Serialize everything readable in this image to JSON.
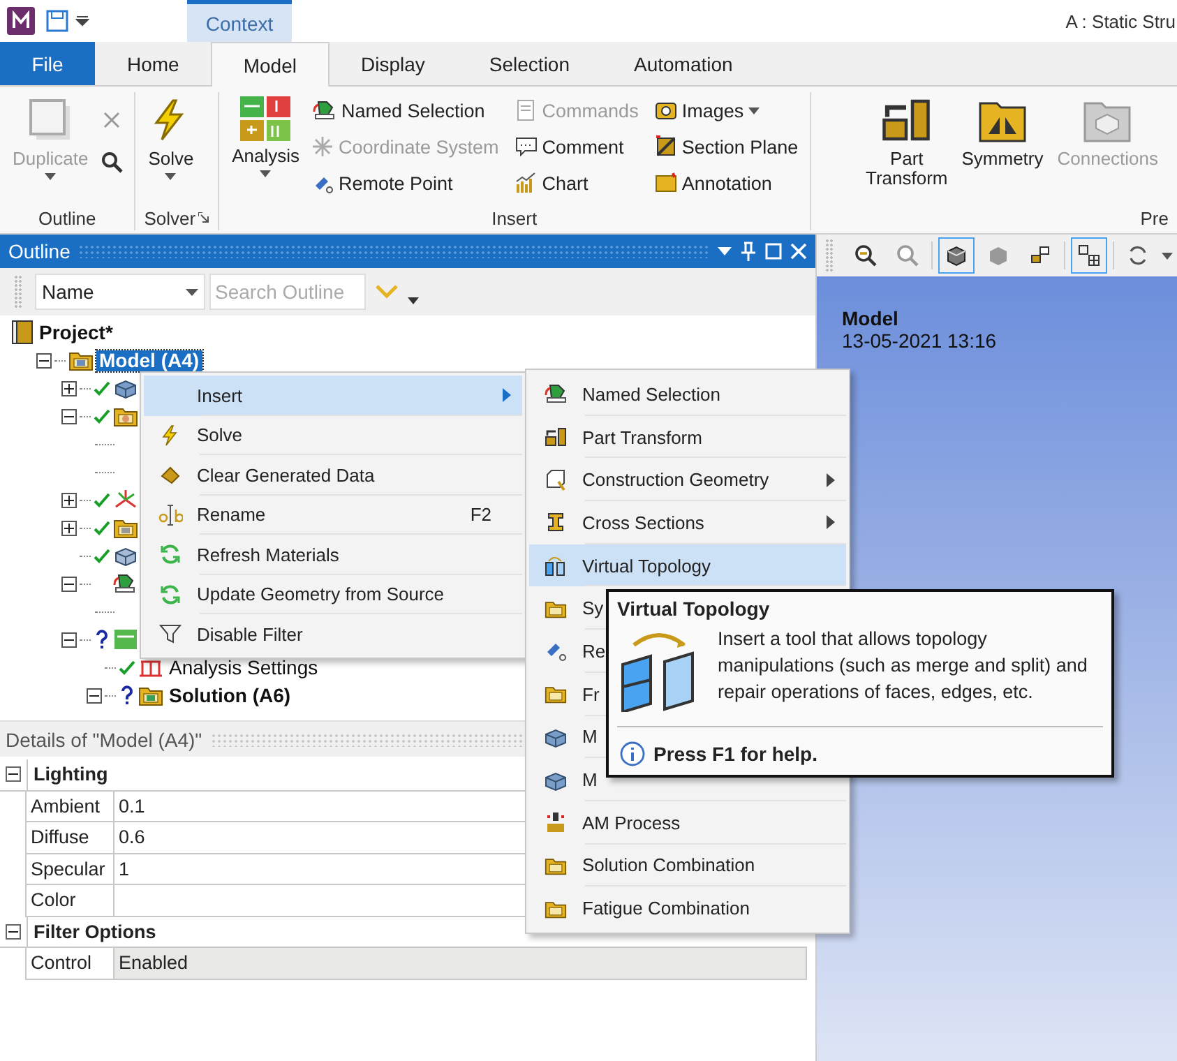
{
  "app": {
    "title": "A : Static Stru",
    "context_tab": "Context"
  },
  "tabs": [
    {
      "label": "File",
      "kind": "file",
      "selected": false
    },
    {
      "label": "Home",
      "kind": "tab",
      "selected": false
    },
    {
      "label": "Model",
      "kind": "tab",
      "selected": true
    },
    {
      "label": "Display",
      "kind": "tab",
      "selected": false
    },
    {
      "label": "Selection",
      "kind": "tab",
      "selected": false
    },
    {
      "label": "Automation",
      "kind": "tab",
      "selected": false
    }
  ],
  "ribbon": {
    "groups": [
      {
        "label": "Outline",
        "kind": "outline",
        "items": [
          {
            "kind": "large",
            "label": "Duplicate",
            "disabled": true,
            "dropdown": true
          },
          {
            "kind": "tool",
            "disabled": true
          },
          {
            "kind": "tool",
            "disabled": false
          }
        ]
      },
      {
        "label": "Solver",
        "kind": "solver",
        "launcher": true,
        "items": [
          {
            "kind": "large",
            "label": "Solve",
            "disabled": false,
            "dropdown": true
          }
        ]
      },
      {
        "label": "Insert",
        "kind": "insert",
        "items": [
          {
            "kind": "large",
            "label": "Analysis",
            "disabled": false,
            "dropdown": true
          },
          {
            "kind": "small",
            "label": "Named Selection",
            "disabled": false,
            "dropdown": false
          },
          {
            "kind": "small",
            "label": "Coordinate System",
            "disabled": true,
            "dropdown": false
          },
          {
            "kind": "small",
            "label": "Remote Point",
            "disabled": false,
            "dropdown": false
          },
          {
            "kind": "small",
            "label": "Commands",
            "disabled": true,
            "dropdown": false
          },
          {
            "kind": "small",
            "label": "Comment",
            "disabled": false,
            "dropdown": false
          },
          {
            "kind": "small",
            "label": "Chart",
            "disabled": false,
            "dropdown": false
          },
          {
            "kind": "small",
            "label": "Images",
            "disabled": false,
            "dropdown": true
          },
          {
            "kind": "small",
            "label": "Section Plane",
            "disabled": false,
            "dropdown": false
          },
          {
            "kind": "small",
            "label": "Annotation",
            "disabled": false,
            "dropdown": false
          }
        ]
      },
      {
        "label": "Pre",
        "kind": "prepare",
        "items": [
          {
            "kind": "large",
            "label": "Part Transform",
            "disabled": false,
            "dropdown": false
          },
          {
            "kind": "large",
            "label": "Symmetry",
            "disabled": false,
            "dropdown": false
          },
          {
            "kind": "large",
            "label": "Connections",
            "disabled": true,
            "dropdown": false
          }
        ]
      }
    ]
  },
  "outline": {
    "title": "Outline",
    "filter": "Name",
    "search": {
      "placeholder": "Search Outline"
    },
    "tree": [
      {
        "label": "Project*",
        "kind": "project",
        "bold": true,
        "selected": false,
        "children": [
          {
            "label": "Model (A4)",
            "kind": "model",
            "bold": true,
            "selected": true,
            "expanded": true,
            "children": [
              {
                "kind": "geometry",
                "expanded": false,
                "ok": true
              },
              {
                "kind": "materials",
                "expanded": true,
                "ok": true,
                "children": [
                  {
                    "kind": "item"
                  },
                  {
                    "kind": "item"
                  }
                ]
              },
              {
                "kind": "coordinates",
                "expanded": false,
                "ok": true
              },
              {
                "kind": "connections",
                "expanded": false,
                "ok": true
              },
              {
                "kind": "mesh",
                "ok": true
              },
              {
                "kind": "selection",
                "expanded": true,
                "children": [
                  {
                    "kind": "item"
                  }
                ]
              },
              {
                "kind": "analysis",
                "expanded": true,
                "ok": false,
                "children": [
                  {
                    "label": "Analysis Settings",
                    "kind": "settings",
                    "bold": false,
                    "ok": true
                  },
                  {
                    "label": "Solution (A6)",
                    "kind": "solution",
                    "bold": true,
                    "expanded": true,
                    "ok": false
                  }
                ]
              }
            ]
          }
        ]
      }
    ]
  },
  "details": {
    "title": "Details of \"Model (A4)\"",
    "groups": [
      {
        "label": "Lighting",
        "expanded": true,
        "rows": [
          {
            "label": "Ambient",
            "value": "0.1",
            "readonly": false
          },
          {
            "label": "Diffuse",
            "value": "0.6",
            "readonly": false
          },
          {
            "label": "Specular",
            "value": "1",
            "readonly": false
          },
          {
            "label": "Color",
            "readonly": false
          }
        ]
      },
      {
        "label": "Filter Options",
        "expanded": true,
        "rows": [
          {
            "label": "Control",
            "value": "Enabled",
            "readonly": true
          }
        ]
      }
    ]
  },
  "viewport": {
    "title": "Model",
    "date": "13-05-2021 13:16"
  },
  "context_menu": {
    "items": [
      {
        "label": "Insert",
        "submenu": true,
        "selected": true
      },
      {
        "label": "Solve",
        "submenu": false,
        "selected": false
      },
      {
        "label": "Clear Generated Data",
        "submenu": false,
        "selected": false
      },
      {
        "label": "Rename",
        "shortcut": "F2",
        "submenu": false,
        "selected": false
      },
      {
        "label": "Refresh Materials",
        "submenu": false,
        "selected": false
      },
      {
        "label": "Update Geometry from Source",
        "submenu": false,
        "selected": false
      },
      {
        "label": "Disable Filter",
        "submenu": false,
        "selected": false
      }
    ]
  },
  "submenu": {
    "items": [
      {
        "label": "Named Selection",
        "submenu": false,
        "selected": false
      },
      {
        "label": "Part Transform",
        "submenu": false,
        "selected": false
      },
      {
        "label": "Construction Geometry",
        "submenu": true,
        "selected": false
      },
      {
        "label": "Cross Sections",
        "submenu": true,
        "selected": false
      },
      {
        "label": "Virtual Topology",
        "submenu": false,
        "selected": true
      },
      {
        "label": "Sy",
        "selected": false
      },
      {
        "label": "Re",
        "selected": false
      },
      {
        "label": "Fr",
        "selected": false
      },
      {
        "label": "M",
        "selected": false
      },
      {
        "label": "M",
        "selected": false
      },
      {
        "label": "AM Process",
        "submenu": false,
        "selected": false
      },
      {
        "label": "Solution Combination",
        "submenu": false,
        "selected": false
      },
      {
        "label": "Fatigue Combination",
        "submenu": false,
        "selected": false
      }
    ]
  },
  "tooltip": {
    "title": "Virtual Topology",
    "body": "Insert a tool that allows topology manipulations (such as merge and split) and repair operations of faces, edges, etc.",
    "help": "Press F1 for help."
  }
}
